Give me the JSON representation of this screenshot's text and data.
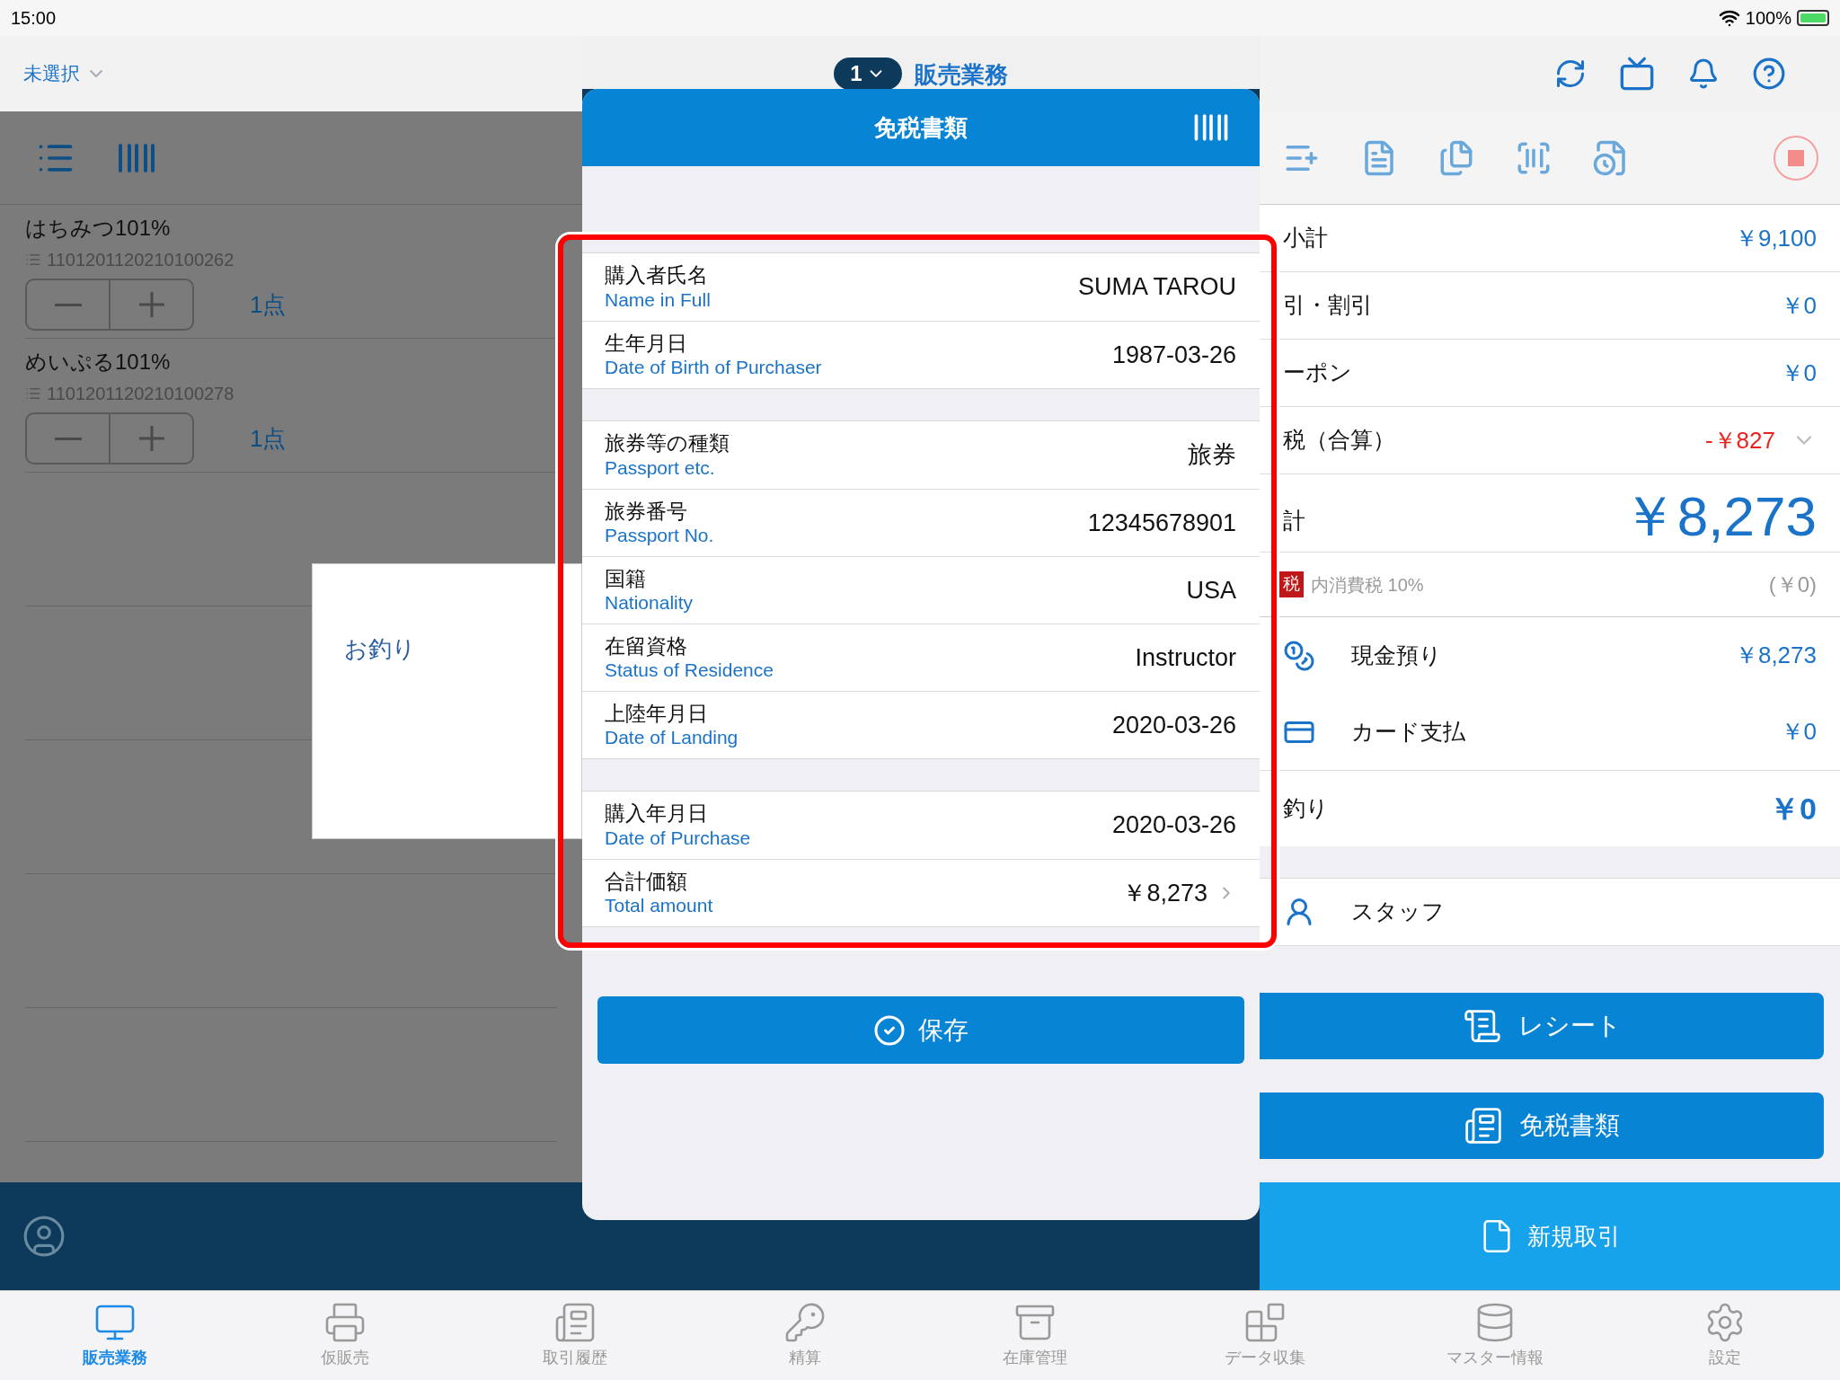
{
  "status_bar": {
    "time": "15:00",
    "battery": "100%"
  },
  "header": {
    "store": "未選択",
    "register_no": "1",
    "title": "販売業務"
  },
  "cart": {
    "items": [
      {
        "name": "はちみつ101%",
        "code": "1101201120210100262",
        "quantity": "1点"
      },
      {
        "name": "めいぷる101%",
        "code": "1101201120210100278",
        "quantity": "1点"
      }
    ]
  },
  "change_popup": {
    "label": "お釣り"
  },
  "modal": {
    "title": "免税書類",
    "groups": [
      [
        {
          "label": "購入者氏名",
          "label_en": "Name in Full",
          "value": "SUMA TAROU",
          "kind": "text"
        },
        {
          "label": "生年月日",
          "label_en": "Date of Birth of Purchaser",
          "value": "1987-03-26",
          "kind": "text"
        }
      ],
      [
        {
          "label": "旅券等の種類",
          "label_en": "Passport etc.",
          "value": "旅券",
          "kind": "text"
        },
        {
          "label": "旅券番号",
          "label_en": "Passport No.",
          "value": "12345678901",
          "kind": "text"
        },
        {
          "label": "国籍",
          "label_en": "Nationality",
          "value": "USA",
          "kind": "text"
        },
        {
          "label": "在留資格",
          "label_en": "Status of Residence",
          "value": "Instructor",
          "kind": "text"
        },
        {
          "label": "上陸年月日",
          "label_en": "Date of Landing",
          "value": "2020-03-26",
          "kind": "text"
        }
      ],
      [
        {
          "label": "購入年月日",
          "label_en": "Date of Purchase",
          "value": "2020-03-26",
          "kind": "text"
        },
        {
          "label": "合計価額",
          "label_en": "Total amount",
          "value": "￥8,273",
          "kind": "link"
        }
      ]
    ],
    "save_button": "保存"
  },
  "summary": {
    "rows": [
      {
        "label": "小計",
        "value": "￥9,100",
        "kind": "normal"
      },
      {
        "label": "引・割引",
        "value": "￥0",
        "kind": "normal"
      },
      {
        "label": "ーポン",
        "value": "￥0",
        "kind": "normal"
      },
      {
        "label": "税（合算）",
        "value": "-￥827",
        "kind": "negative"
      }
    ],
    "total": {
      "label": "計",
      "value": "￥8,273"
    },
    "tax_note": {
      "badge": "税",
      "text": "内消費税 10%",
      "value": "(￥0)"
    },
    "payments": [
      {
        "label": "現金預り",
        "value": "￥8,273",
        "kind": "cash"
      },
      {
        "label": "カード支払",
        "value": "￥0",
        "kind": "card"
      }
    ],
    "change": {
      "label": "釣り",
      "value": "￥0"
    },
    "staff": "スタッフ",
    "buttons": [
      {
        "label": "レシート",
        "kind": "receipt"
      },
      {
        "label": "免税書類",
        "kind": "taxfree"
      }
    ],
    "new_transaction": "新規取引"
  },
  "tab_bar": [
    {
      "label": "販売業務",
      "selected": true,
      "kind": "register"
    },
    {
      "label": "仮販売",
      "selected": false,
      "kind": "temp"
    },
    {
      "label": "取引履歴",
      "selected": false,
      "kind": "history"
    },
    {
      "label": "精算",
      "selected": false,
      "kind": "settle"
    },
    {
      "label": "在庫管理",
      "selected": false,
      "kind": "stock"
    },
    {
      "label": "データ収集",
      "selected": false,
      "kind": "data"
    },
    {
      "label": "マスター情報",
      "selected": false,
      "kind": "master"
    },
    {
      "label": "設定",
      "selected": false,
      "kind": "settings"
    }
  ]
}
